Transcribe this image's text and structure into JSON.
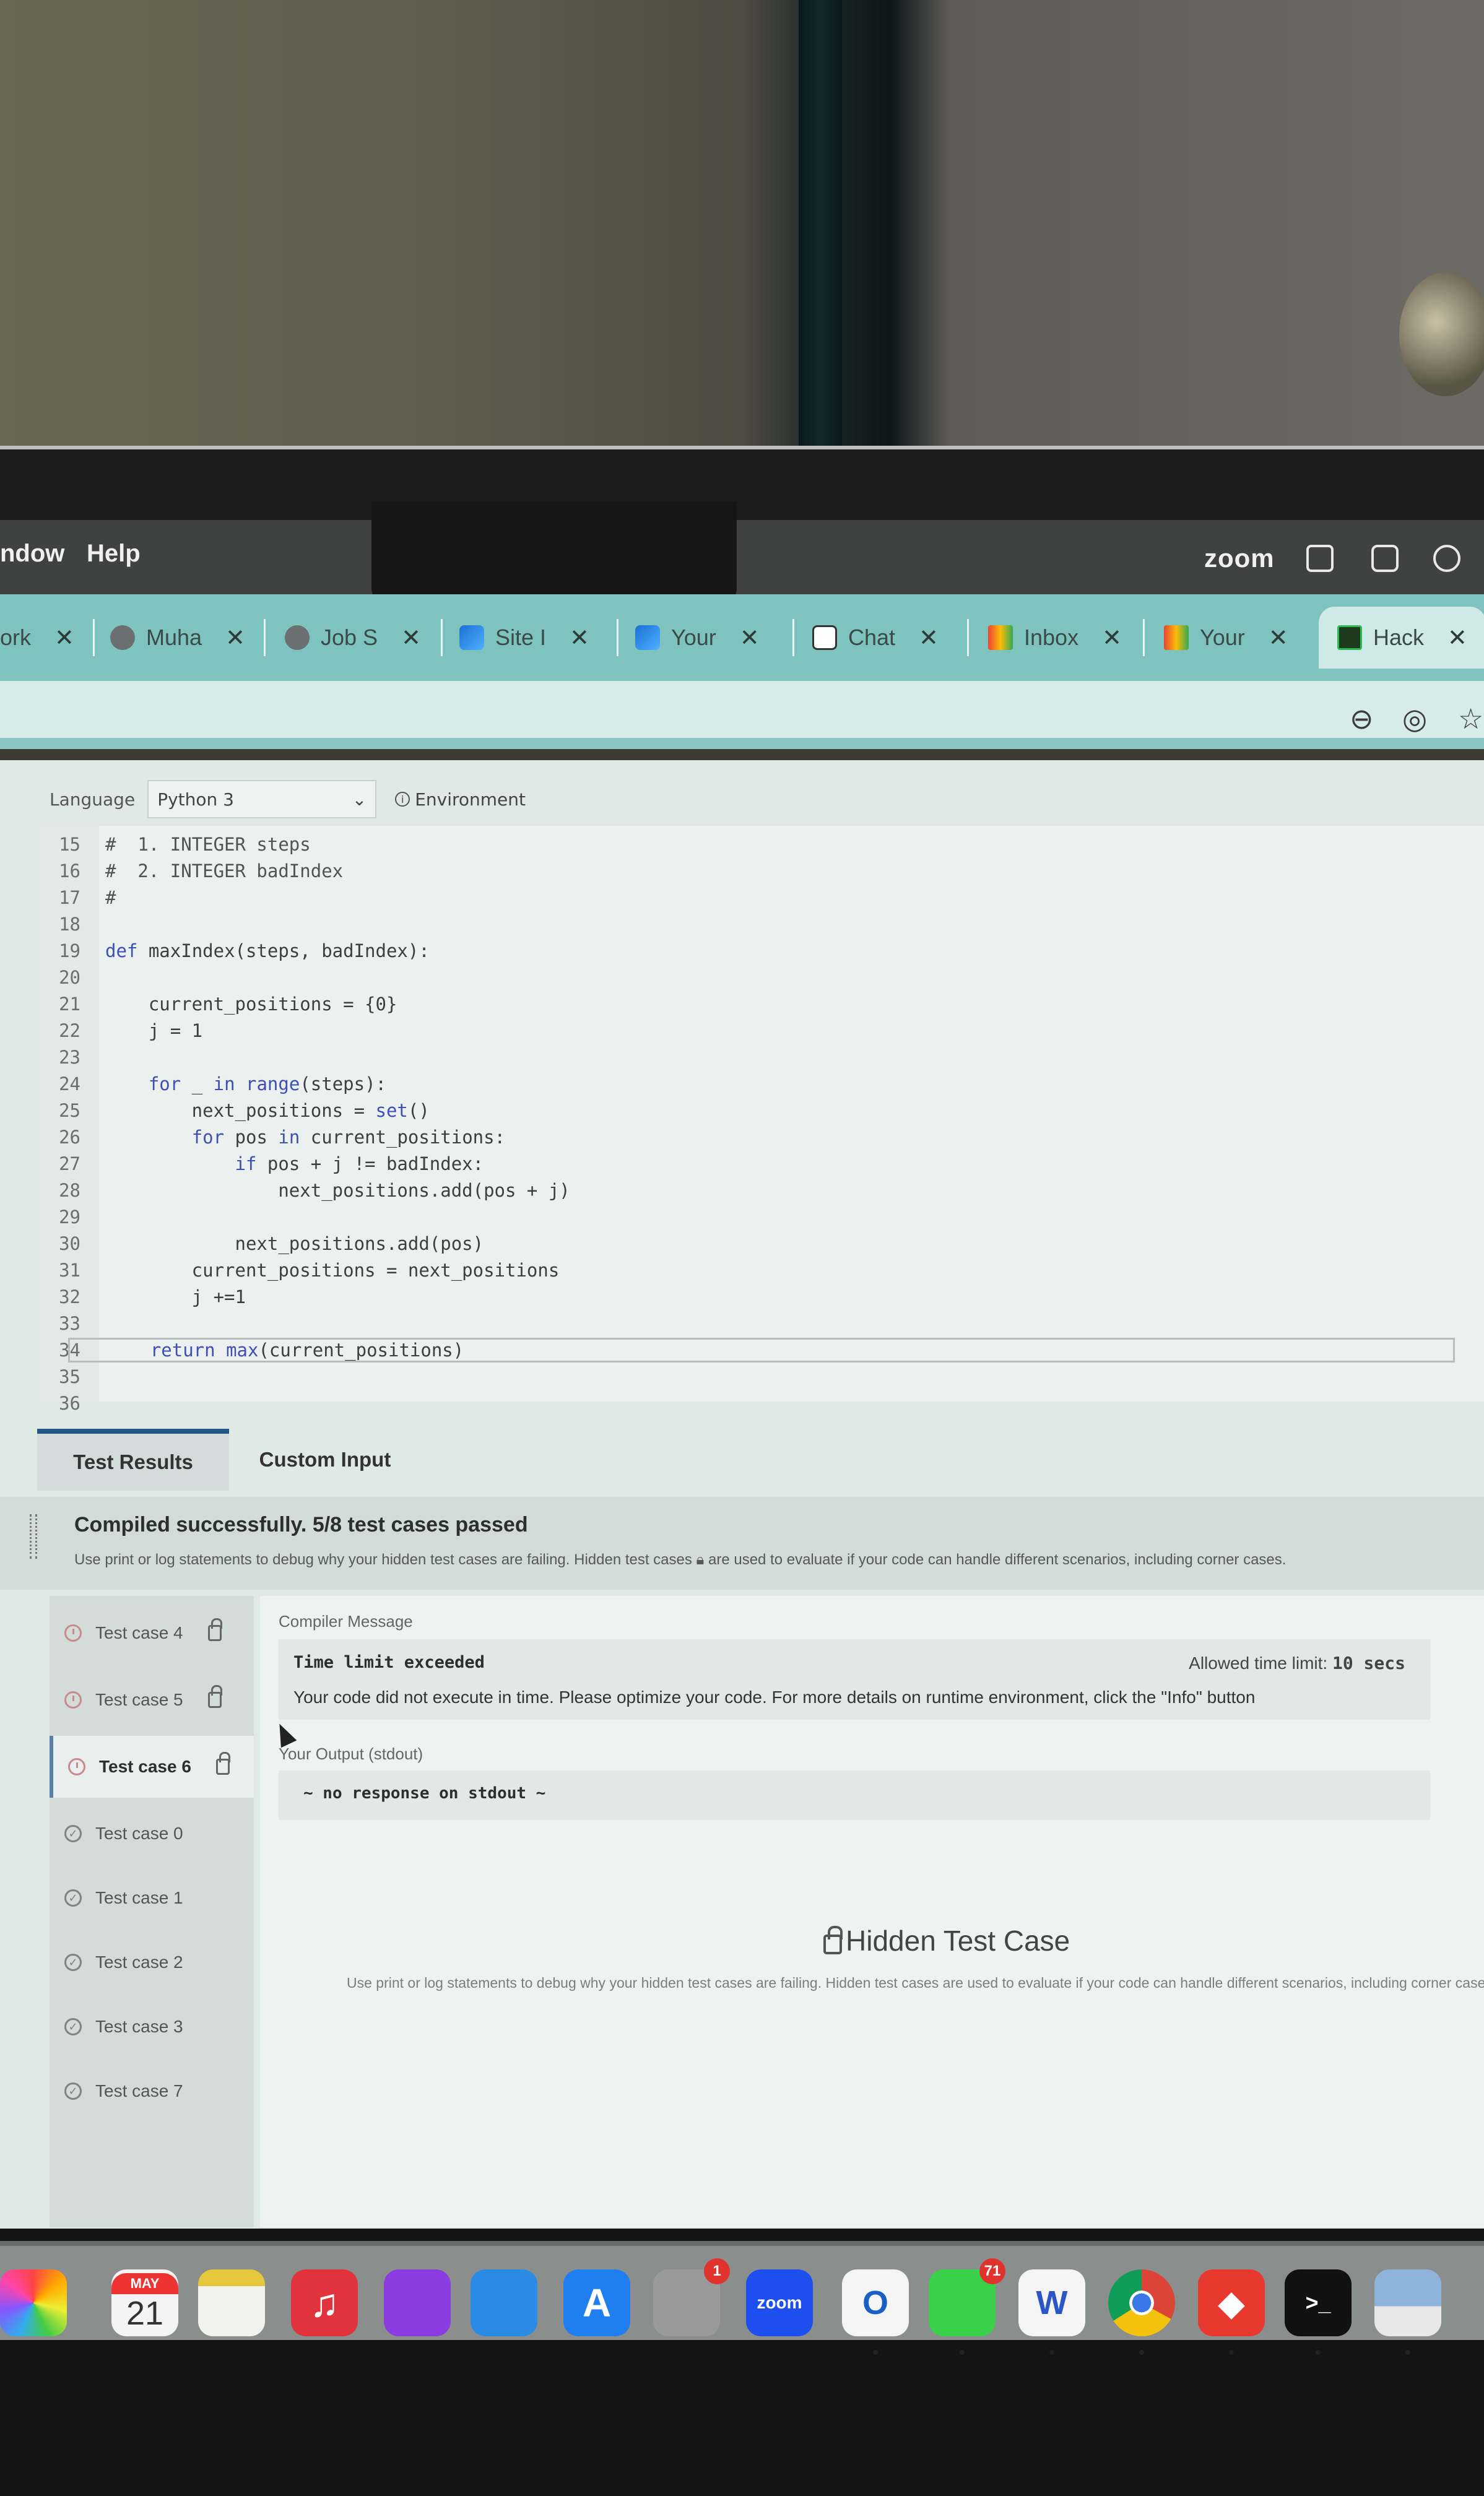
{
  "menubar": {
    "items": [
      "ndow",
      "Help"
    ],
    "right_app": "zoom",
    "status_icons": [
      "outlook-status-icon",
      "screen-mirror-icon",
      "airdrop-icon"
    ]
  },
  "browser": {
    "tabs": [
      {
        "label": "ork",
        "icon": "generic-favicon",
        "active": false
      },
      {
        "label": "Muha",
        "icon": "globe-favicon",
        "active": false
      },
      {
        "label": "Job S",
        "icon": "globe-favicon",
        "active": false
      },
      {
        "label": "Site I",
        "icon": "edge-favicon",
        "active": false
      },
      {
        "label": "Your",
        "icon": "edge-favicon",
        "active": false
      },
      {
        "label": "Chat",
        "icon": "chatgpt-favicon",
        "active": false
      },
      {
        "label": "Inbox",
        "icon": "gmail-favicon",
        "active": false
      },
      {
        "label": "Your",
        "icon": "gmail-favicon",
        "active": false
      },
      {
        "label": "Hack",
        "icon": "hackerrank-favicon",
        "active": true
      }
    ],
    "toolbar_icons": [
      "zoom-out-icon",
      "eye-slash-icon",
      "bookmark-star-icon"
    ]
  },
  "editor": {
    "language_label": "Language",
    "language_value": "Python 3",
    "environment_label": "Environment",
    "lines": [
      {
        "n": "15",
        "text": "#  1. INTEGER steps"
      },
      {
        "n": "16",
        "text": "#  2. INTEGER badIndex"
      },
      {
        "n": "17",
        "text": "#"
      },
      {
        "n": "18",
        "text": ""
      },
      {
        "n": "19",
        "text": "def maxIndex(steps, badIndex):"
      },
      {
        "n": "20",
        "text": ""
      },
      {
        "n": "21",
        "text": "    current_positions = {0}"
      },
      {
        "n": "22",
        "text": "    j = 1"
      },
      {
        "n": "23",
        "text": ""
      },
      {
        "n": "24",
        "text": "    for _ in range(steps):"
      },
      {
        "n": "25",
        "text": "        next_positions = set()"
      },
      {
        "n": "26",
        "text": "        for pos in current_positions:"
      },
      {
        "n": "27",
        "text": "            if pos + j != badIndex:"
      },
      {
        "n": "28",
        "text": "                next_positions.add(pos + j)"
      },
      {
        "n": "29",
        "text": ""
      },
      {
        "n": "30",
        "text": "            next_positions.add(pos)"
      },
      {
        "n": "31",
        "text": "        current_positions = next_positions"
      },
      {
        "n": "32",
        "text": "        j +=1"
      },
      {
        "n": "33",
        "text": ""
      },
      {
        "n": "34",
        "text": "    return max(current_positions)"
      },
      {
        "n": "35",
        "text": ""
      },
      {
        "n": "36",
        "text": ""
      }
    ]
  },
  "results": {
    "tabs": [
      "Test Results",
      "Custom Input"
    ],
    "summary_title": "Compiled successfully. 5/8 test cases passed",
    "summary_desc": "Use print or log statements to debug why your hidden test cases are failing. Hidden test cases",
    "summary_desc_tail": "are used to evaluate if your code can handle different scenarios, including corner cases.",
    "test_cases": [
      {
        "label": "Test case 4",
        "status": "failed",
        "hidden": true,
        "selected": false
      },
      {
        "label": "Test case 5",
        "status": "failed",
        "hidden": true,
        "selected": false
      },
      {
        "label": "Test case 6",
        "status": "failed",
        "hidden": true,
        "selected": true
      },
      {
        "label": "Test case 0",
        "status": "passed",
        "hidden": false,
        "selected": false
      },
      {
        "label": "Test case 1",
        "status": "passed",
        "hidden": false,
        "selected": false
      },
      {
        "label": "Test case 2",
        "status": "passed",
        "hidden": false,
        "selected": false
      },
      {
        "label": "Test case 3",
        "status": "passed",
        "hidden": false,
        "selected": false
      },
      {
        "label": "Test case 7",
        "status": "passed",
        "hidden": false,
        "selected": false
      }
    ],
    "compiler_message_label": "Compiler Message",
    "compiler_message_title": "Time limit exceeded",
    "allowed_time_label": "Allowed time limit:",
    "allowed_time_value": "10 secs",
    "compiler_message_body": "Your code did not execute in time. Please optimize your code. For more details on runtime environment, click the \"Info\" button",
    "output_label": "Your Output (stdout)",
    "output_value": "~ no response on stdout ~",
    "hidden_title": "Hidden Test Case",
    "hidden_desc": "Use print or log statements to debug why your hidden test cases are failing. Hidden test cases are used to evaluate if your code can handle different scenarios, including corner cases."
  },
  "dock": {
    "apps": [
      {
        "name": "photos",
        "label": ""
      },
      {
        "name": "calendar",
        "label": "21",
        "month": "MAY"
      },
      {
        "name": "notes",
        "label": ""
      },
      {
        "name": "music",
        "label": "♫"
      },
      {
        "name": "podcasts",
        "label": ""
      },
      {
        "name": "keynote",
        "label": ""
      },
      {
        "name": "app-store",
        "label": "A"
      },
      {
        "name": "system-settings",
        "label": "",
        "badge": "1"
      },
      {
        "name": "zoom",
        "label": "zoom"
      },
      {
        "name": "outlook",
        "label": "O"
      },
      {
        "name": "messages",
        "label": "",
        "badge": "71"
      },
      {
        "name": "word",
        "label": "W"
      },
      {
        "name": "chrome",
        "label": ""
      },
      {
        "name": "anydesk",
        "label": "◆"
      },
      {
        "name": "terminal",
        "label": ">_"
      },
      {
        "name": "preview",
        "label": ""
      }
    ]
  }
}
